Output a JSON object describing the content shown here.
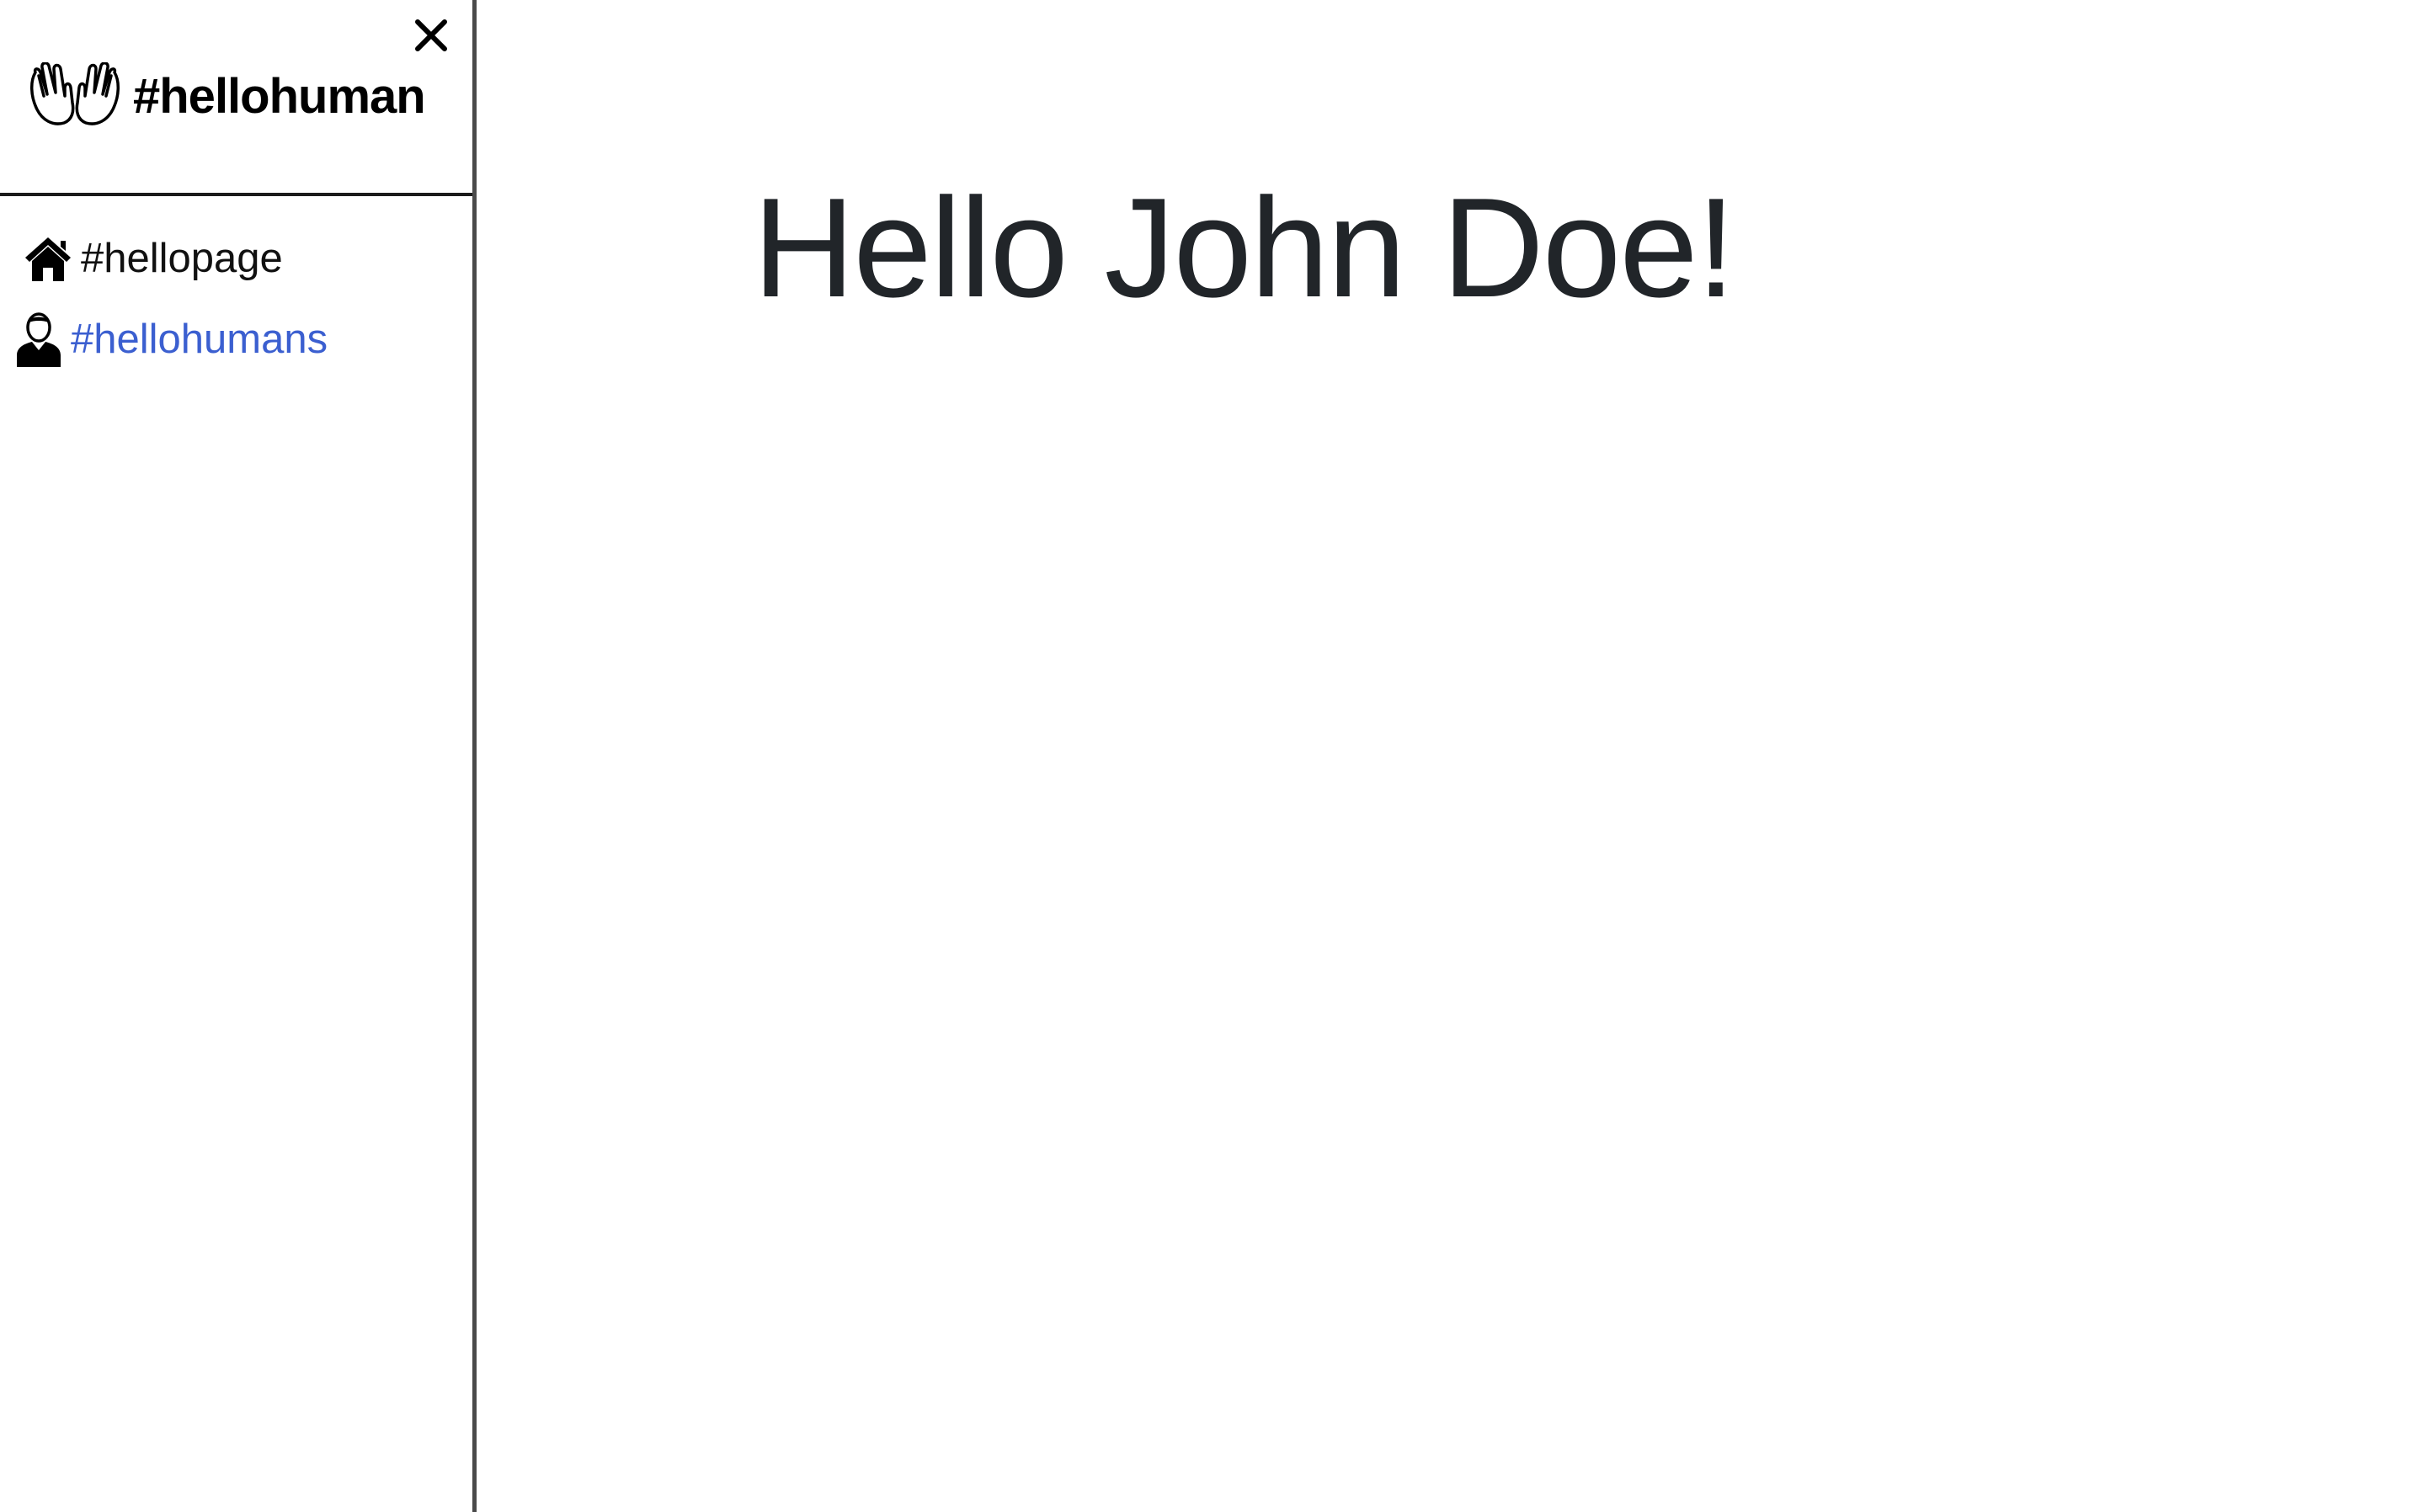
{
  "sidebar": {
    "brand": {
      "name": "#hellohuman",
      "icon": "waving-hands-icon"
    },
    "close_icon": "close-icon",
    "items": [
      {
        "label": "#hellopage",
        "icon": "home-icon",
        "active": false
      },
      {
        "label": "#hellohumans",
        "icon": "user-icon",
        "active": true
      }
    ]
  },
  "main": {
    "greeting": "Hello John Doe!"
  },
  "colors": {
    "active_link": "#3b5fd0",
    "heading": "#212529",
    "divider": "#4a4a4a"
  }
}
